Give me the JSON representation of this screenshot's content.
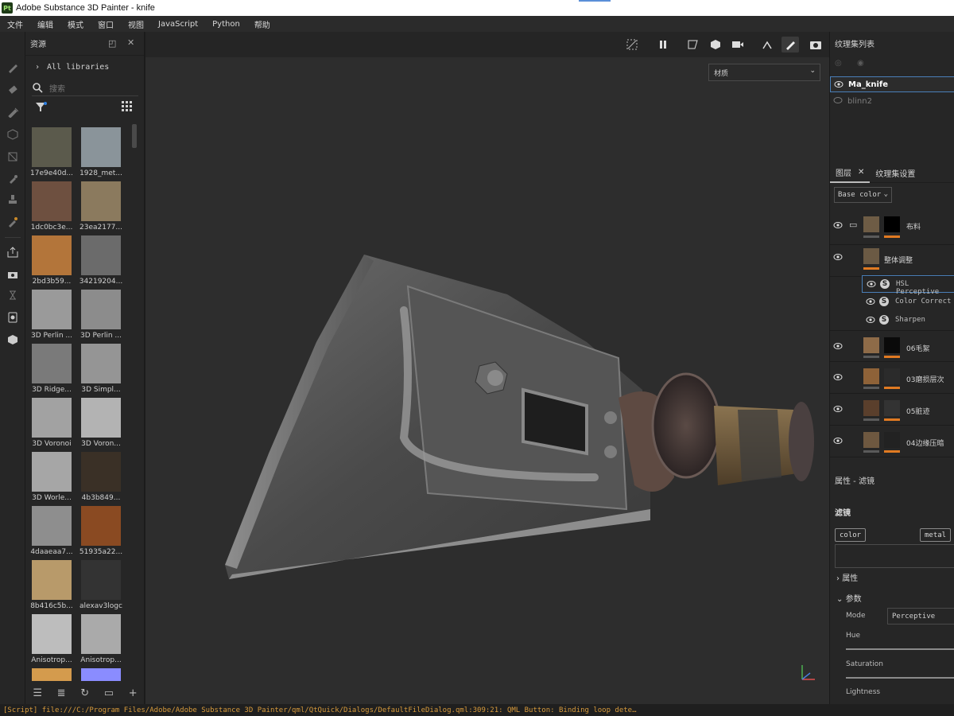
{
  "window": {
    "title": "Adobe Substance 3D Painter - knife",
    "logo": "Pt"
  },
  "menu": [
    "文件",
    "编辑",
    "模式",
    "窗口",
    "视图",
    "JavaScript",
    "Python",
    "帮助"
  ],
  "tools": [
    "paint-brush-icon",
    "eraser-icon",
    "projection-icon",
    "geometry-mask-icon",
    "polygon-fill-icon",
    "smudge-icon",
    "clone-stamp-icon",
    "color-picker-icon",
    "export-icon",
    "bake-icon",
    "texture-set-icon",
    "display-settings-icon",
    "shelf-icon"
  ],
  "assets": {
    "title": "资源",
    "library": "All libraries",
    "search_placeholder": "搜索",
    "items": [
      {
        "label": "17e9e40d...",
        "color": "#5b5a4c"
      },
      {
        "label": "1928_met...",
        "color": "#8a949a"
      },
      {
        "label": "1dc0bc3e...",
        "color": "#6e5040"
      },
      {
        "label": "23ea2177...",
        "color": "#8b7a5e"
      },
      {
        "label": "2bd3b59...",
        "color": "#b3753a"
      },
      {
        "label": "34219204...",
        "color": "#6b6b6b"
      },
      {
        "label": "3D Perlin ...",
        "color": "#9a9a9a"
      },
      {
        "label": "3D Perlin ...",
        "color": "#8c8c8c"
      },
      {
        "label": "3D Ridge...",
        "color": "#7a7a7a"
      },
      {
        "label": "3D Simpl...",
        "color": "#959595"
      },
      {
        "label": "3D Voronoi",
        "color": "#a2a2a2"
      },
      {
        "label": "3D Voron...",
        "color": "#b3b3b3"
      },
      {
        "label": "3D Worle...",
        "color": "#a6a6a6"
      },
      {
        "label": "4b3b849...",
        "color": "#3a3026"
      },
      {
        "label": "4daaeaa7...",
        "color": "#8e8e8e"
      },
      {
        "label": "51935a22...",
        "color": "#8a4a22"
      },
      {
        "label": "8b416c5b...",
        "color": "#b89a6a"
      },
      {
        "label": "alexav3logc",
        "color": "#333333"
      },
      {
        "label": "Anisotrop...",
        "color": "#bdbdbd"
      },
      {
        "label": "Anisotrop...",
        "color": "#aaaaaa"
      },
      {
        "label": "",
        "color": "#d49b4d"
      },
      {
        "label": "",
        "color": "#8a8cff"
      }
    ]
  },
  "viewport": {
    "material_selector": "材质",
    "toolbar_icons": [
      "hide-icon",
      "pause-icon",
      "camera-mode-icon",
      "cube-icon",
      "video-icon",
      "symmetry-icon",
      "brush-icon",
      "screenshot-icon"
    ]
  },
  "texture_sets": {
    "title": "纹理集列表",
    "items": [
      {
        "name": "Ma_knife",
        "selected": true
      },
      {
        "name": "blinn2",
        "selected": false
      }
    ]
  },
  "layers": {
    "tab_layers": "图层",
    "tab_settings": "纹理集设置",
    "channel": "Base color",
    "items": [
      {
        "name": "布料",
        "swatch": "#6e5c45",
        "mask": "#000000"
      },
      {
        "name": "整体调整",
        "swatch": "#6b5a44"
      },
      {
        "name": "06毛絮",
        "swatch": "#8e6b48",
        "mask": "#0a0a0a"
      },
      {
        "name": "03磨损层次",
        "swatch": "#8e6238",
        "mask": "#2b2b2b"
      },
      {
        "name": "05脏迹",
        "swatch": "#5a3f2c",
        "mask": "#333333"
      },
      {
        "name": "04边缘压暗",
        "swatch": "#6e5840",
        "mask": "#222222"
      }
    ],
    "filters": [
      "HSL Perceptive",
      "Color Correct",
      "Sharpen"
    ]
  },
  "properties": {
    "title": "属性 - 滤镜",
    "filter_label": "滤镜",
    "chip_color": "color",
    "chip_metal": "metal",
    "group_attrs": "属性",
    "group_params": "参数",
    "mode_label": "Mode",
    "mode_value": "Perceptive",
    "hue_label": "Hue",
    "saturation_label": "Saturation",
    "lightness_label": "Lightness"
  },
  "status": "[Script] file:///C:/Program Files/Adobe/Adobe Substance 3D Painter/qml/QtQuick/Dialogs/DefaultFileDialog.qml:309:21: QML Button: Binding loop dete…",
  "colors": {
    "accent": "#4a7fb8",
    "orange": "#e07a22",
    "status": "#d89b3c"
  }
}
